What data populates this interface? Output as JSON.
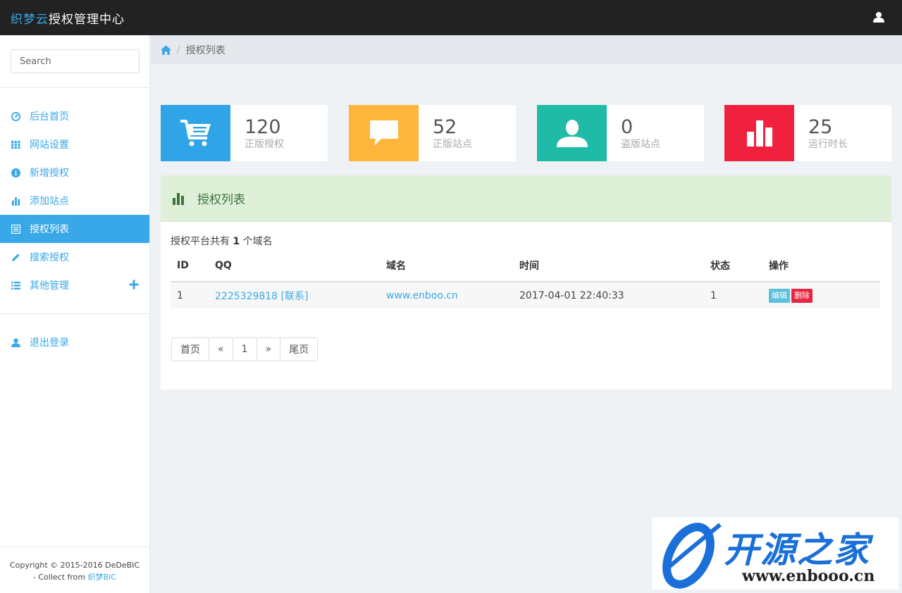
{
  "header": {
    "brand_prefix": "织梦云",
    "brand_suffix": "授权管理中心",
    "user_icon": "user-icon"
  },
  "sidebar": {
    "search_placeholder": "Search",
    "items": [
      {
        "label": "后台首页",
        "icon": "dashboard-icon"
      },
      {
        "label": "网站设置",
        "icon": "grid-icon"
      },
      {
        "label": "新增授权",
        "icon": "info-icon"
      },
      {
        "label": "添加站点",
        "icon": "bar-chart-icon"
      },
      {
        "label": "授权列表",
        "icon": "list-alt-icon",
        "active": true
      },
      {
        "label": "搜索授权",
        "icon": "pencil-icon"
      },
      {
        "label": "其他管理",
        "icon": "list-icon"
      }
    ],
    "logout_label": "退出登录",
    "footer_line1": "Copyright © 2015-2016 DeDeBIC",
    "footer_line2_prefix": "- Collect from ",
    "footer_link": "织梦BIC"
  },
  "breadcrumb": {
    "current": "授权列表"
  },
  "stats": [
    {
      "value": "120",
      "label": "正版授权",
      "color": "#2fa4e7",
      "icon": "cart-icon"
    },
    {
      "value": "52",
      "label": "正版站点",
      "color": "#fdb53c",
      "icon": "comment-icon"
    },
    {
      "value": "0",
      "label": "盗版站点",
      "color": "#1fbba6",
      "icon": "user-icon"
    },
    {
      "value": "25",
      "label": "运行时长",
      "color": "#f0213f",
      "icon": "bar-chart-icon"
    }
  ],
  "panel": {
    "title": "授权列表",
    "summary_prefix": "授权平台共有",
    "summary_count": "1",
    "summary_suffix": "个域名",
    "columns": [
      "ID",
      "QQ",
      "域名",
      "时间",
      "状态",
      "操作"
    ],
    "rows": [
      {
        "id": "1",
        "qq": "2225329818 [联系]",
        "domain": "www.enboo.cn",
        "time": "2017-04-01 22:40:33",
        "status": "1",
        "edit": "编辑",
        "delete": "删除"
      }
    ],
    "pager": [
      "首页",
      "«",
      "1",
      "»",
      "尾页"
    ]
  },
  "watermark": {
    "title": "开源之家",
    "url": "www.enbooo.cn"
  }
}
